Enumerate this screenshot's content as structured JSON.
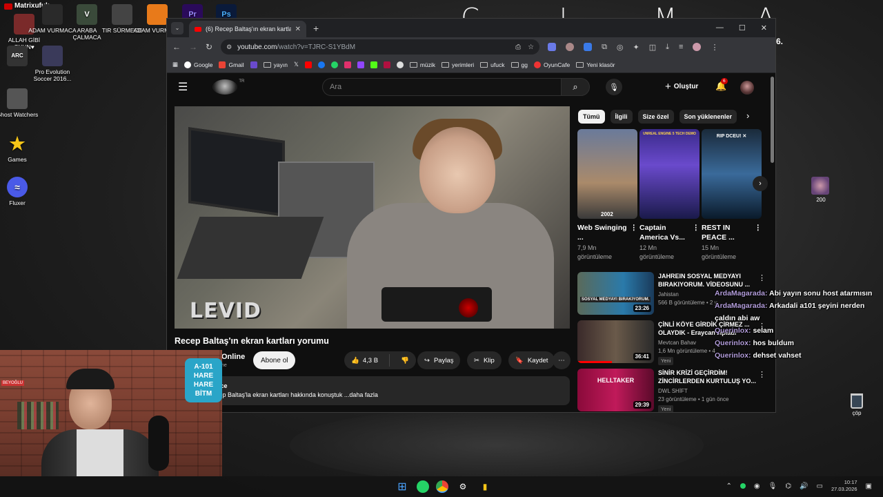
{
  "desktop": {
    "deco_letters": "C L M A",
    "deco_digit": "6.",
    "icons": [
      {
        "label": "Matrixufuk",
        "color": "#cc0000"
      },
      {
        "label": "ALLAH GİBİ OYUN♥",
        "color": "#7a2a2a"
      },
      {
        "label": "ADAM VURMACA",
        "color": "#2a2a2a"
      },
      {
        "label": "ARABA ÇALMACA",
        "color": "#3a4a3a"
      },
      {
        "label": "TIR SÜRMECE",
        "color": "#444"
      },
      {
        "label": "ADAM VURMACA",
        "color": "#e87a1a"
      },
      {
        "label": "Pr",
        "color": "#2a0a5a"
      },
      {
        "label": "Ps",
        "color": "#0a1a3a"
      },
      {
        "label": "ARC Raiders",
        "color": "#333"
      },
      {
        "label": "Pro Evolution Soccer 2016...",
        "color": "#3a3a5a"
      },
      {
        "label": "Ghost Watchers",
        "color": "#555"
      },
      {
        "label": "Games",
        "color": "#f5c518"
      },
      {
        "label": "Fluxer",
        "color": "#4a5ae8"
      }
    ],
    "side_avatar_label": "200",
    "recycle_label": "çöp"
  },
  "browser": {
    "tab_title": "(6) Recep Baltaş'ın ekran kartlar",
    "url_host": "youtube.com",
    "url_path": "/watch?v=TJRC-S1YBdM",
    "bookmarks": [
      {
        "label": "",
        "kind": "apps"
      },
      {
        "label": "Google",
        "kind": "google"
      },
      {
        "label": "Gmail",
        "kind": "gmail"
      },
      {
        "label": "",
        "kind": "ext1"
      },
      {
        "label": "yayın",
        "kind": "folder"
      },
      {
        "label": "",
        "kind": "x"
      },
      {
        "label": "",
        "kind": "yt"
      },
      {
        "label": "",
        "kind": "fb"
      },
      {
        "label": "",
        "kind": "wa"
      },
      {
        "label": "",
        "kind": "ig"
      },
      {
        "label": "",
        "kind": "tw"
      },
      {
        "label": "",
        "kind": "kick"
      },
      {
        "label": "",
        "kind": "r"
      },
      {
        "label": "",
        "kind": "gh"
      },
      {
        "label": "müzik",
        "kind": "folder"
      },
      {
        "label": "yerimleri",
        "kind": "folder"
      },
      {
        "label": "ufuck",
        "kind": "folder"
      },
      {
        "label": "gg",
        "kind": "folder"
      },
      {
        "label": "OyunCafe",
        "kind": "oc"
      },
      {
        "label": "Yeni klasör",
        "kind": "folder"
      }
    ]
  },
  "youtube": {
    "country": "TR",
    "search_placeholder": "Ara",
    "create_label": "Oluştur",
    "notif_count": "6",
    "player_watermark": "LEVID",
    "video_title": "Recep Baltaş'ın ekran kartları yorumu",
    "channel_name": "Online",
    "channel_sub": "ne",
    "subscribe_label": "Abone ol",
    "likes": "4,3 B",
    "share_label": "Paylaş",
    "clip_label": "Klip",
    "save_label": "Kaydet",
    "desc_meta": "eme  15 yıl önce",
    "desc_text": "n Editörü Recep Baltaş'la ekran kartları hakkında konuştuk ...daha fazla",
    "chips": [
      "Tümü",
      "İlgili",
      "Size özel",
      "Son yüklenenler"
    ],
    "shorts": [
      {
        "title": "Web Swinging ...",
        "views": "7,9 Mn",
        "views_unit": "görüntüleme",
        "grad": "linear-gradient(180deg,#6a7a9a 0%,#aa8a6a 60%,#3a3a3a 100%)",
        "cap": "2002"
      },
      {
        "title": "Captain America Vs...",
        "views": "12 Mn",
        "views_unit": "görüntüleme",
        "grad": "linear-gradient(180deg,#3a2a8a 0%,#6a4acc 40%,#1a1a4a 100%)",
        "cap": "UNREAL ENGINE 5 TECH DEMO"
      },
      {
        "title": "REST IN PEACE ...",
        "views": "15 Mn",
        "views_unit": "görüntüleme",
        "grad": "linear-gradient(180deg,#1a2a3a 0%,#3a6a9a 50%,#0a1a2a 100%)",
        "cap": "RIP DCEU! ✕"
      }
    ],
    "recs": [
      {
        "title": "JAHREIN SOSYAL MEDYAYI BIRAKIYORUM. VİDEOSUNU ...",
        "channel": "Jahistan",
        "meta": "566 B görüntüleme • 2 y",
        "duration": "23:26",
        "badge": "",
        "grad": "linear-gradient(90deg,#5a6a5a 0%,#2a7aaa 60%,#1a3a5a 100%)",
        "caption": "SOSYAL MEDYAYI BIRAKIYORUM."
      },
      {
        "title": "ÇİNLİ KÖYE GİRDİK ÇİRMEZ ... OLAYDIK - Eraycan zıpladı",
        "channel": "Mevtcan Bahav",
        "meta": "1,6 Mn görüntüleme • 4",
        "duration": "36:41",
        "badge": "Yeni",
        "grad": "linear-gradient(90deg,#3a2a2a 0%,#6a5a4a 50%,#2a2a2a 100%)",
        "caption": ""
      },
      {
        "title": "SİNİR KRİZİ GEÇİRDİM! ZİNCİRLERDEN KURTULUŞ YO...",
        "channel": "DWL SHİFT",
        "meta": "23 görüntüleme • 1 gün önce",
        "duration": "29:39",
        "badge": "Yeni",
        "grad": "linear-gradient(90deg,#8a0a3a 0%,#c01a5a 50%,#5a0a2a 100%)",
        "caption": "HELLTAKER"
      }
    ]
  },
  "chat": [
    {
      "user": "ArdaMagarada:",
      "msg": "Abi yayın sonu host atarmısın"
    },
    {
      "user": "ArdaMagarada:",
      "msg": "Arkadali a101 şeyini nerden"
    },
    {
      "user": "",
      "msg": "çaldın abi aw"
    },
    {
      "user": "Querinlox:",
      "msg": "selam"
    },
    {
      "user": "Querinlox:",
      "msg": "hos buldum"
    },
    {
      "user": "Querinlox:",
      "msg": "dehset vahset"
    }
  ],
  "webcam": {
    "sign_text": "A-101 HARE HARE BİTM",
    "street_text": "BEYOĞLU"
  },
  "taskbar": {
    "time": "10:17",
    "date": "27.03.2026"
  }
}
